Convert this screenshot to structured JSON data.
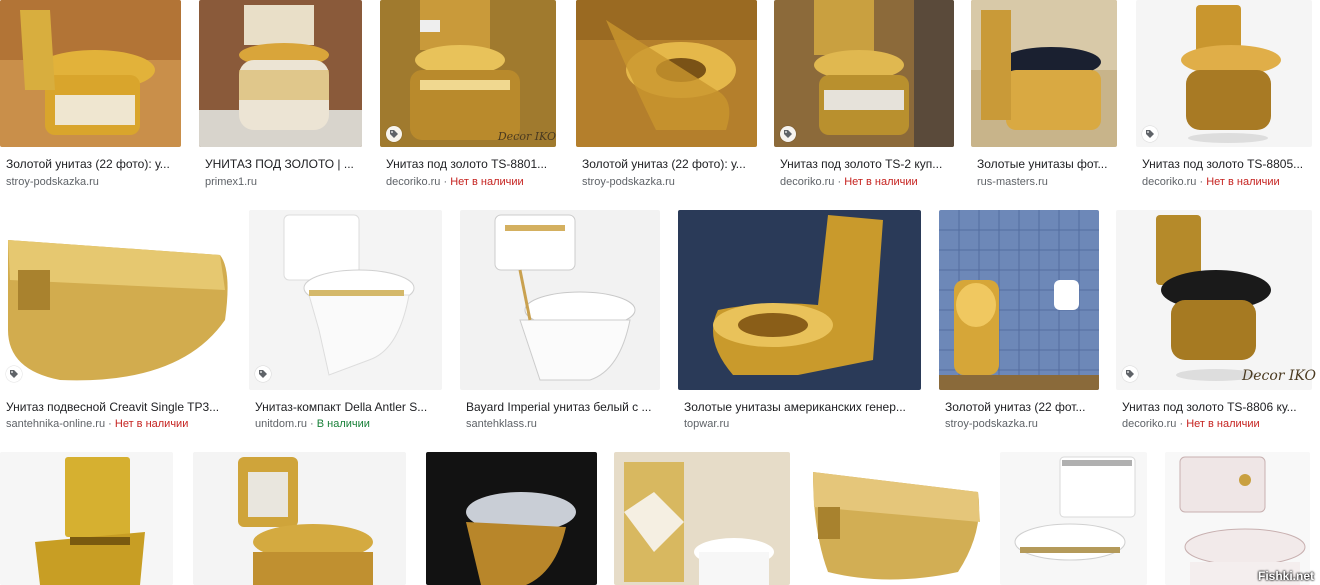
{
  "colors": {
    "stock_out": "#c5221f",
    "stock_in": "#188038",
    "text": "#202124",
    "source": "#5f6368"
  },
  "row1": [
    {
      "title": "Золотой унитаз (22 фото): у...",
      "source": "stroy-podskazka.ru",
      "stock": "",
      "tag": false
    },
    {
      "title": "УНИТАЗ ПОД ЗОЛОТО | ...",
      "source": "primex1.ru",
      "stock": "",
      "tag": false
    },
    {
      "title": "Унитаз под золото TS-8801...",
      "source": "decoriko.ru",
      "stock": "Нет в наличии",
      "tag": true,
      "decor": "Decor IKO"
    },
    {
      "title": "Золотой унитаз (22 фото): у...",
      "source": "stroy-podskazka.ru",
      "stock": "",
      "tag": false
    },
    {
      "title": "Унитаз под золото TS-2 куп...",
      "source": "decoriko.ru",
      "stock": "Нет в наличии",
      "tag": true
    },
    {
      "title": "Золотые унитазы фот...",
      "source": "rus-masters.ru",
      "stock": "",
      "tag": false
    },
    {
      "title": "Унитаз под золото TS-8805...",
      "source": "decoriko.ru",
      "stock": "Нет в наличии",
      "tag": true
    }
  ],
  "row2": [
    {
      "title": "Унитаз подвесной Creavit Single TP3...",
      "source": "santehnika-online.ru",
      "stock": "Нет в наличии",
      "tag": true
    },
    {
      "title": "Унитаз-компакт Della Antler S...",
      "source": "unitdom.ru",
      "stock": "В наличии",
      "stock_type": "in",
      "tag": true
    },
    {
      "title": "Bayard Imperial унитаз белый с ...",
      "source": "santehklass.ru",
      "stock": "",
      "tag": false
    },
    {
      "title": "Золотые унитазы американских генер...",
      "source": "topwar.ru",
      "stock": "",
      "tag": false
    },
    {
      "title": "Золотой унитаз (22 фот...",
      "source": "stroy-podskazka.ru",
      "stock": "",
      "tag": false
    },
    {
      "title": "Унитаз под золото TS-8806 ку...",
      "source": "decoriko.ru",
      "stock": "Нет в наличии",
      "tag": true,
      "decor": "Decor IKO"
    }
  ],
  "watermark": "Fishki.net",
  "separator": "·"
}
